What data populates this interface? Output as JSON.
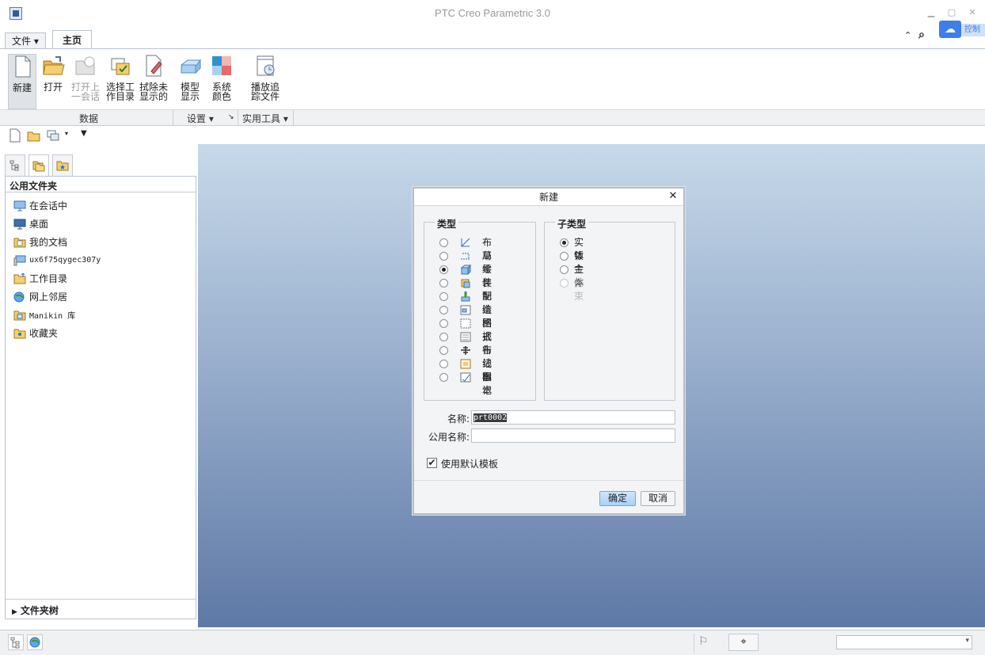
{
  "window": {
    "title": "PTC Creo Parametric 3.0"
  },
  "tabs": [
    {
      "label": "文件 ▾"
    },
    {
      "label": "主页"
    }
  ],
  "cloud_tab": {
    "label": "控制"
  },
  "ribbon": {
    "buttons": [
      {
        "line1": "新建",
        "line2": ""
      },
      {
        "line1": "打开",
        "line2": ""
      },
      {
        "line1": "打开上",
        "line2": "一会话"
      },
      {
        "line1": "选择工",
        "line2": "作目录"
      },
      {
        "line1": "拭除未",
        "line2": "显示的"
      },
      {
        "line1": "模型",
        "line2": "显示"
      },
      {
        "line1": "系统",
        "line2": "颜色"
      },
      {
        "line1": "播放追",
        "line2": "踪文件"
      }
    ],
    "groups": {
      "data": "数据",
      "settings": "设置 ▾",
      "tools": "实用工具 ▾"
    }
  },
  "left_panel": {
    "header": "公用文件夹",
    "items": [
      {
        "label": "在会话中"
      },
      {
        "label": "桌面"
      },
      {
        "label": "我的文档"
      },
      {
        "label": "ux6f75qygec307y"
      },
      {
        "label": "工作目录"
      },
      {
        "label": "网上邻居"
      },
      {
        "label": "Manikin 库"
      },
      {
        "label": "收藏夹"
      }
    ],
    "footer": "文件夹树"
  },
  "dialog": {
    "title": "新建",
    "type_legend": "类型",
    "subtype_legend": "子类型",
    "types": [
      {
        "label": "布局",
        "selected": false
      },
      {
        "label": "草绘",
        "selected": false
      },
      {
        "label": "零件",
        "selected": true
      },
      {
        "label": "装配",
        "selected": false
      },
      {
        "label": "制造",
        "selected": false
      },
      {
        "label": "绘图",
        "selected": false
      },
      {
        "label": "格式",
        "selected": false
      },
      {
        "label": "报告",
        "selected": false
      },
      {
        "label": "布线图",
        "selected": false
      },
      {
        "label": "记事本",
        "selected": false
      },
      {
        "label": "标记",
        "selected": false
      }
    ],
    "subtypes": [
      {
        "label": "实体",
        "selected": true,
        "disabled": false
      },
      {
        "label": "钣金件",
        "selected": false,
        "disabled": false
      },
      {
        "label": "主体",
        "selected": false,
        "disabled": false
      },
      {
        "label": "线束",
        "selected": false,
        "disabled": true
      }
    ],
    "name_label": "名称:",
    "name_value": "prt0002",
    "common_name_label": "公用名称:",
    "common_name_value": "",
    "use_template_label": "使用默认模板",
    "use_template_checked": true,
    "ok_label": "确定",
    "cancel_label": "取消"
  },
  "colors": {
    "accent": "#3d7ee8",
    "viewport_top": "#c7d9ea",
    "viewport_bottom": "#5e79a6"
  }
}
